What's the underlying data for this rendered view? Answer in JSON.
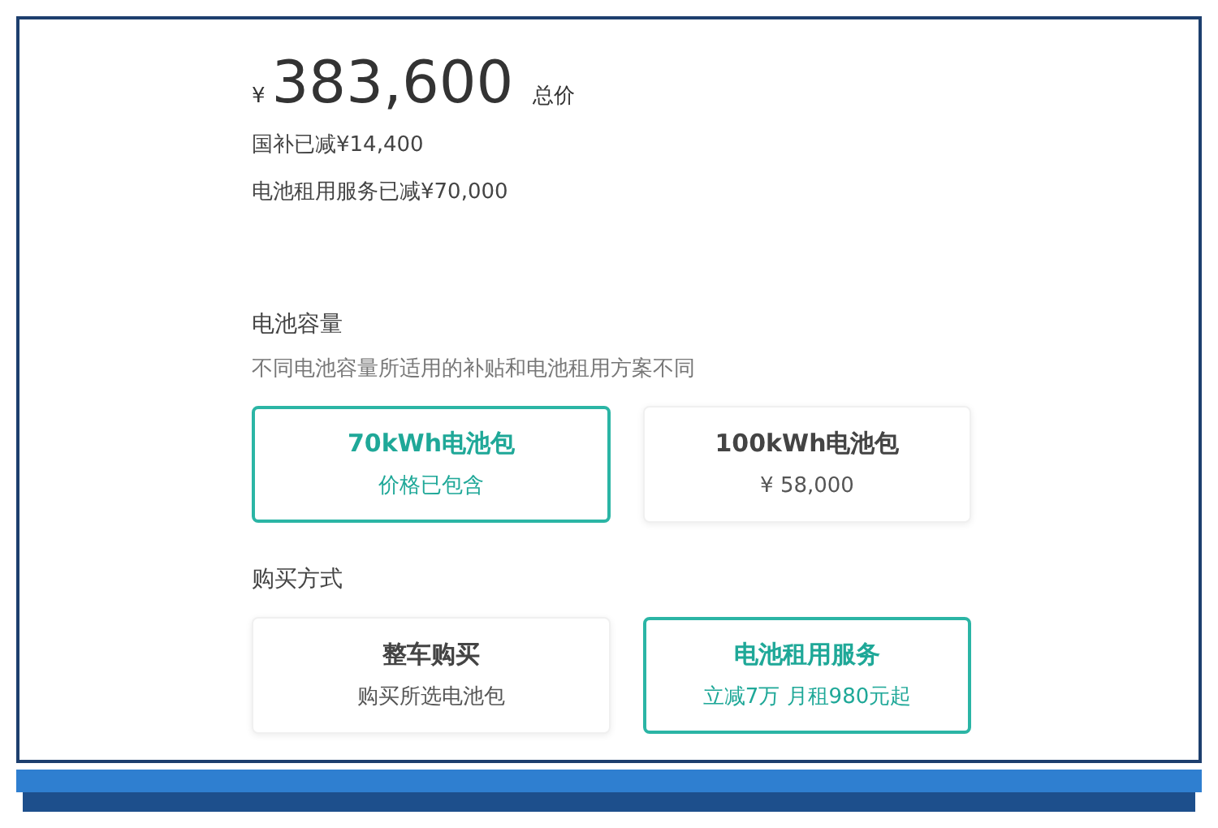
{
  "price": {
    "currency": "¥",
    "amount": "383,600",
    "label": "总价"
  },
  "discounts": [
    "国补已减¥14,400",
    "电池租用服务已减¥70,000"
  ],
  "sections": [
    {
      "title": "电池容量",
      "subtitle": "不同电池容量所适用的补贴和电池租用方案不同",
      "options": [
        {
          "title": "70kWh电池包",
          "detail": "价格已包含",
          "selected": true
        },
        {
          "title": "100kWh电池包",
          "detail": "¥ 58,000",
          "selected": false
        }
      ]
    },
    {
      "title": "购买方式",
      "options": [
        {
          "title": "整车购买",
          "detail": "购买所选电池包",
          "selected": false
        },
        {
          "title": "电池租用服务",
          "detail": "立减7万 月租980元起",
          "selected": true
        }
      ]
    }
  ]
}
